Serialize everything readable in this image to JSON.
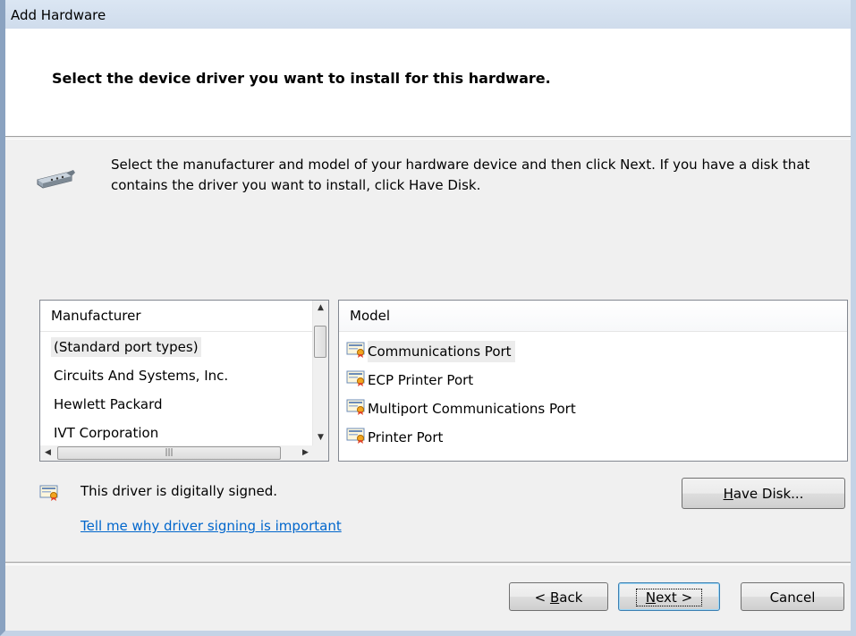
{
  "window": {
    "title": "Add Hardware"
  },
  "header": {
    "title": "Select the device driver you want to install for this hardware."
  },
  "description": "Select the manufacturer and model of your hardware device and then click Next. If you have a disk that contains the driver you want to install, click Have Disk.",
  "manufacturer": {
    "header": "Manufacturer",
    "items": [
      "(Standard port types)",
      "Circuits And Systems, Inc.",
      "Hewlett Packard",
      "IVT Corporation"
    ],
    "selected_index": 0
  },
  "model": {
    "header": "Model",
    "items": [
      "Communications Port",
      "ECP Printer Port",
      "Multiport Communications Port",
      "Printer Port"
    ],
    "selected_index": 0
  },
  "signing": {
    "status_text": "This driver is digitally signed.",
    "link_text": "Tell me why driver signing is important"
  },
  "buttons": {
    "have_disk_prefix": "",
    "have_disk_key": "H",
    "have_disk_rest": "ave Disk...",
    "back_prefix": "< ",
    "back_key": "B",
    "back_rest": "ack",
    "next_key": "N",
    "next_rest": "ext >",
    "cancel": "Cancel"
  },
  "icons": {
    "port": "serial-port-icon",
    "certificate": "certificate-icon"
  },
  "colors": {
    "link": "#0066cc",
    "selection": "#ececec",
    "window_border": "#8aa2c0"
  }
}
